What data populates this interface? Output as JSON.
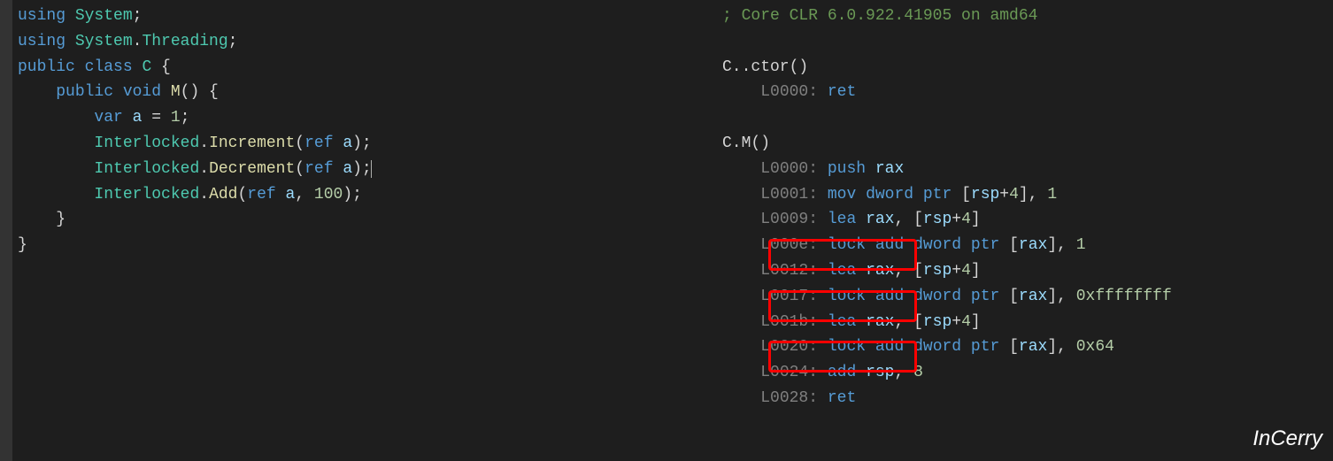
{
  "left": {
    "lines": [
      [
        {
          "t": "using ",
          "c": "kw"
        },
        {
          "t": "System",
          "c": "type"
        },
        {
          "t": ";",
          "c": "punct"
        }
      ],
      [
        {
          "t": "using ",
          "c": "kw"
        },
        {
          "t": "System",
          "c": "type"
        },
        {
          "t": ".",
          "c": "punct"
        },
        {
          "t": "Threading",
          "c": "type"
        },
        {
          "t": ";",
          "c": "punct"
        }
      ],
      [
        {
          "t": "public class ",
          "c": "kw"
        },
        {
          "t": "C",
          "c": "type"
        },
        {
          "t": " {",
          "c": "punct"
        }
      ],
      [
        {
          "t": "    ",
          "c": "punct"
        },
        {
          "t": "public void ",
          "c": "kw"
        },
        {
          "t": "M",
          "c": "method"
        },
        {
          "t": "() {",
          "c": "punct"
        }
      ],
      [
        {
          "t": "        ",
          "c": "punct"
        },
        {
          "t": "var",
          "c": "kw"
        },
        {
          "t": " ",
          "c": "punct"
        },
        {
          "t": "a",
          "c": "param"
        },
        {
          "t": " = ",
          "c": "punct"
        },
        {
          "t": "1",
          "c": "num"
        },
        {
          "t": ";",
          "c": "punct"
        }
      ],
      [
        {
          "t": "        ",
          "c": "punct"
        },
        {
          "t": "Interlocked",
          "c": "type"
        },
        {
          "t": ".",
          "c": "punct"
        },
        {
          "t": "Increment",
          "c": "method"
        },
        {
          "t": "(",
          "c": "punct"
        },
        {
          "t": "ref",
          "c": "kw"
        },
        {
          "t": " ",
          "c": "punct"
        },
        {
          "t": "a",
          "c": "param"
        },
        {
          "t": ");",
          "c": "punct"
        }
      ],
      [
        {
          "t": "        ",
          "c": "punct"
        },
        {
          "t": "Interlocked",
          "c": "type"
        },
        {
          "t": ".",
          "c": "punct"
        },
        {
          "t": "Decrement",
          "c": "method"
        },
        {
          "t": "(",
          "c": "punct"
        },
        {
          "t": "ref",
          "c": "kw"
        },
        {
          "t": " ",
          "c": "punct"
        },
        {
          "t": "a",
          "c": "param"
        },
        {
          "t": ");",
          "c": "punct"
        },
        {
          "t": "",
          "c": "cursor"
        }
      ],
      [
        {
          "t": "        ",
          "c": "punct"
        },
        {
          "t": "Interlocked",
          "c": "type"
        },
        {
          "t": ".",
          "c": "punct"
        },
        {
          "t": "Add",
          "c": "method"
        },
        {
          "t": "(",
          "c": "punct"
        },
        {
          "t": "ref",
          "c": "kw"
        },
        {
          "t": " ",
          "c": "punct"
        },
        {
          "t": "a",
          "c": "param"
        },
        {
          "t": ", ",
          "c": "punct"
        },
        {
          "t": "100",
          "c": "num"
        },
        {
          "t": ");",
          "c": "punct"
        }
      ],
      [
        {
          "t": "    }",
          "c": "punct"
        }
      ],
      [
        {
          "t": "}",
          "c": "punct"
        }
      ]
    ]
  },
  "right": {
    "lines": [
      [
        {
          "t": "; Core CLR 6.0.922.41905 on amd64",
          "c": "comment"
        }
      ],
      [],
      [
        {
          "t": "C..ctor()",
          "c": "white"
        }
      ],
      [
        {
          "t": "    ",
          "c": "white"
        },
        {
          "t": "L0000:",
          "c": "label"
        },
        {
          "t": " ",
          "c": "white"
        },
        {
          "t": "ret",
          "c": "instr"
        }
      ],
      [],
      [
        {
          "t": "C.M()",
          "c": "white"
        }
      ],
      [
        {
          "t": "    ",
          "c": "white"
        },
        {
          "t": "L0000:",
          "c": "label"
        },
        {
          "t": " ",
          "c": "white"
        },
        {
          "t": "push",
          "c": "instr"
        },
        {
          "t": " ",
          "c": "white"
        },
        {
          "t": "rax",
          "c": "reg"
        }
      ],
      [
        {
          "t": "    ",
          "c": "white"
        },
        {
          "t": "L0001:",
          "c": "label"
        },
        {
          "t": " ",
          "c": "white"
        },
        {
          "t": "mov",
          "c": "instr"
        },
        {
          "t": " ",
          "c": "white"
        },
        {
          "t": "dword ptr",
          "c": "kw"
        },
        {
          "t": " [",
          "c": "white"
        },
        {
          "t": "rsp",
          "c": "reg"
        },
        {
          "t": "+",
          "c": "white"
        },
        {
          "t": "4",
          "c": "hex"
        },
        {
          "t": "], ",
          "c": "white"
        },
        {
          "t": "1",
          "c": "hex"
        }
      ],
      [
        {
          "t": "    ",
          "c": "white"
        },
        {
          "t": "L0009:",
          "c": "label"
        },
        {
          "t": " ",
          "c": "white"
        },
        {
          "t": "lea",
          "c": "instr"
        },
        {
          "t": " ",
          "c": "white"
        },
        {
          "t": "rax",
          "c": "reg"
        },
        {
          "t": ", [",
          "c": "white"
        },
        {
          "t": "rsp",
          "c": "reg"
        },
        {
          "t": "+",
          "c": "white"
        },
        {
          "t": "4",
          "c": "hex"
        },
        {
          "t": "]",
          "c": "white"
        }
      ],
      [
        {
          "t": "    ",
          "c": "white"
        },
        {
          "t": "L000e:",
          "c": "label"
        },
        {
          "t": " ",
          "c": "white"
        },
        {
          "t": "lock",
          "c": "lock-instr"
        },
        {
          "t": " ",
          "c": "white"
        },
        {
          "t": "add",
          "c": "instr"
        },
        {
          "t": " ",
          "c": "white"
        },
        {
          "t": "dword ptr",
          "c": "kw"
        },
        {
          "t": " [",
          "c": "white"
        },
        {
          "t": "rax",
          "c": "reg"
        },
        {
          "t": "], ",
          "c": "white"
        },
        {
          "t": "1",
          "c": "hex"
        }
      ],
      [
        {
          "t": "    ",
          "c": "white"
        },
        {
          "t": "L0012:",
          "c": "label"
        },
        {
          "t": " ",
          "c": "white"
        },
        {
          "t": "lea",
          "c": "instr"
        },
        {
          "t": " ",
          "c": "white"
        },
        {
          "t": "rax",
          "c": "reg"
        },
        {
          "t": ", [",
          "c": "white"
        },
        {
          "t": "rsp",
          "c": "reg"
        },
        {
          "t": "+",
          "c": "white"
        },
        {
          "t": "4",
          "c": "hex"
        },
        {
          "t": "]",
          "c": "white"
        }
      ],
      [
        {
          "t": "    ",
          "c": "white"
        },
        {
          "t": "L0017:",
          "c": "label"
        },
        {
          "t": " ",
          "c": "white"
        },
        {
          "t": "lock",
          "c": "lock-instr"
        },
        {
          "t": " ",
          "c": "white"
        },
        {
          "t": "add",
          "c": "instr"
        },
        {
          "t": " ",
          "c": "white"
        },
        {
          "t": "dword ptr",
          "c": "kw"
        },
        {
          "t": " [",
          "c": "white"
        },
        {
          "t": "rax",
          "c": "reg"
        },
        {
          "t": "], ",
          "c": "white"
        },
        {
          "t": "0xffffffff",
          "c": "hex"
        }
      ],
      [
        {
          "t": "    ",
          "c": "white"
        },
        {
          "t": "L001b:",
          "c": "label"
        },
        {
          "t": " ",
          "c": "white"
        },
        {
          "t": "lea",
          "c": "instr"
        },
        {
          "t": " ",
          "c": "white"
        },
        {
          "t": "rax",
          "c": "reg"
        },
        {
          "t": ", [",
          "c": "white"
        },
        {
          "t": "rsp",
          "c": "reg"
        },
        {
          "t": "+",
          "c": "white"
        },
        {
          "t": "4",
          "c": "hex"
        },
        {
          "t": "]",
          "c": "white"
        }
      ],
      [
        {
          "t": "    ",
          "c": "white"
        },
        {
          "t": "L0020:",
          "c": "label"
        },
        {
          "t": " ",
          "c": "white"
        },
        {
          "t": "lock",
          "c": "lock-instr"
        },
        {
          "t": " ",
          "c": "white"
        },
        {
          "t": "add",
          "c": "instr"
        },
        {
          "t": " ",
          "c": "white"
        },
        {
          "t": "dword ptr",
          "c": "kw"
        },
        {
          "t": " [",
          "c": "white"
        },
        {
          "t": "rax",
          "c": "reg"
        },
        {
          "t": "], ",
          "c": "white"
        },
        {
          "t": "0x64",
          "c": "hex"
        }
      ],
      [
        {
          "t": "    ",
          "c": "white"
        },
        {
          "t": "L0024:",
          "c": "label"
        },
        {
          "t": " ",
          "c": "white"
        },
        {
          "t": "add",
          "c": "instr"
        },
        {
          "t": " ",
          "c": "white"
        },
        {
          "t": "rsp",
          "c": "reg"
        },
        {
          "t": ", ",
          "c": "white"
        },
        {
          "t": "8",
          "c": "hex"
        }
      ],
      [
        {
          "t": "    ",
          "c": "white"
        },
        {
          "t": "L0028:",
          "c": "label"
        },
        {
          "t": " ",
          "c": "white"
        },
        {
          "t": "ret",
          "c": "instr"
        }
      ]
    ]
  },
  "watermark": "InCerry"
}
